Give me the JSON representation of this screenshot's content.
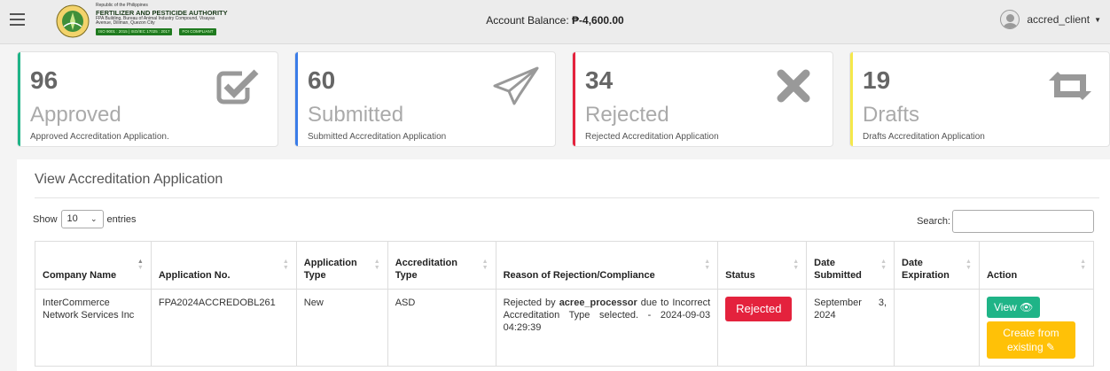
{
  "header": {
    "org_country": "Republic of the Philippines",
    "org_name": "FERTILIZER AND PESTICIDE AUTHORITY",
    "org_address_1": "FPA Building, Bureau of Animal Industry Compound, Visayas",
    "org_address_2": "Avenue, Diliman, Quezon City",
    "iso_badge": "ISO 9001 : 2015 | ISO/IEC 17025 : 2017",
    "foi_badge": "FOI COMPLIANT",
    "balance_label": "Account Balance:",
    "balance_value": "₱-4,600.00",
    "username": "accred_client"
  },
  "stats": [
    {
      "count": "96",
      "label": "Approved",
      "description": "Approved Accreditation Application.",
      "color": "#1fb487",
      "icon": "check-square-icon"
    },
    {
      "count": "60",
      "label": "Submitted",
      "description": "Submitted Accreditation Application",
      "color": "#3a7ce8",
      "icon": "paper-plane-icon"
    },
    {
      "count": "34",
      "label": "Rejected",
      "description": "Rejected Accreditation Application",
      "color": "#e4223d",
      "icon": "x-icon"
    },
    {
      "count": "19",
      "label": "Drafts",
      "description": "Drafts Accreditation Application",
      "color": "#f5e84a",
      "icon": "retweet-icon"
    }
  ],
  "panel": {
    "title": "View Accreditation Application",
    "show_label": "Show",
    "entries_value": "10",
    "entries_label": "entries",
    "search_label": "Search:",
    "search_value": ""
  },
  "table": {
    "columns": [
      "Company Name",
      "Application No.",
      "Application Type",
      "Accreditation Type",
      "Reason of Rejection/Compliance",
      "Status",
      "Date Submitted",
      "Date Expiration",
      "Action"
    ],
    "rows": [
      {
        "company": "InterCommerce Network Services Inc",
        "app_no": "FPA2024ACCREDOBL261",
        "app_type": "New",
        "accred_type": "ASD",
        "reason_prefix": "Rejected by",
        "reason_user": "acree_processor",
        "reason_suffix": "due to Incorrect Accreditation Type selected. - 2024-09-03 04:29:39",
        "status": "Rejected",
        "date_submitted": "September 3, 2024",
        "date_expiration": "",
        "view_label": "View",
        "create_label": "Create from existing"
      }
    ]
  }
}
